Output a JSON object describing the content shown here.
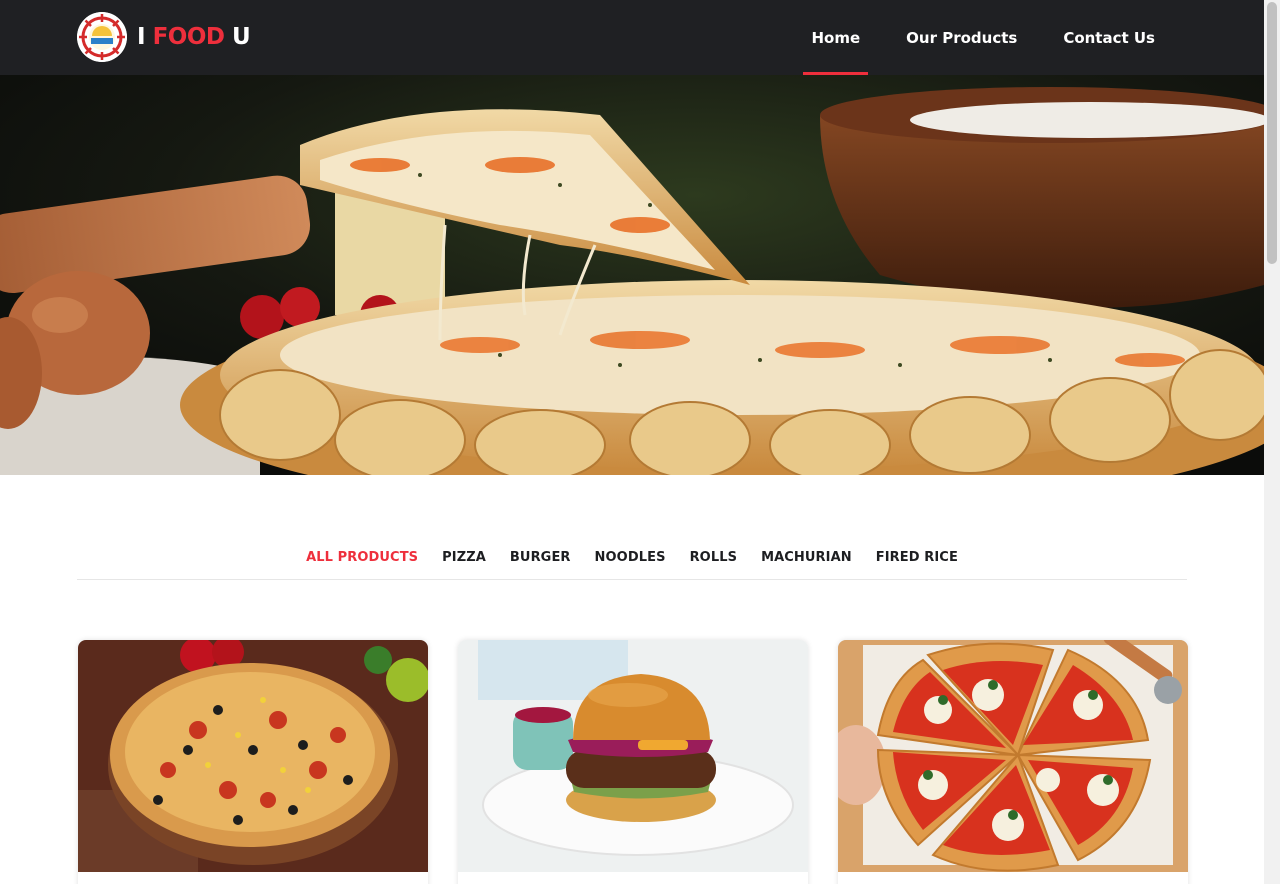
{
  "brand": {
    "prefix": "I",
    "highlight": "FOOD",
    "suffix": "U"
  },
  "nav": {
    "items": [
      {
        "label": "Home",
        "active": true
      },
      {
        "label": "Our Products",
        "active": false
      },
      {
        "label": "Contact Us",
        "active": false
      }
    ]
  },
  "filters": {
    "items": [
      "ALL PRODUCTS",
      "PIZZA",
      "BURGER",
      "NOODLES",
      "ROLLS",
      "MACHURIAN",
      "FIRED RICE"
    ],
    "active": "ALL PRODUCTS"
  },
  "colors": {
    "accent": "#ee2f3c",
    "header_bg": "#1f2023"
  },
  "products": [
    {
      "image": "pizza-image"
    },
    {
      "image": "burger-image"
    },
    {
      "image": "sliced-pizza-image"
    }
  ]
}
